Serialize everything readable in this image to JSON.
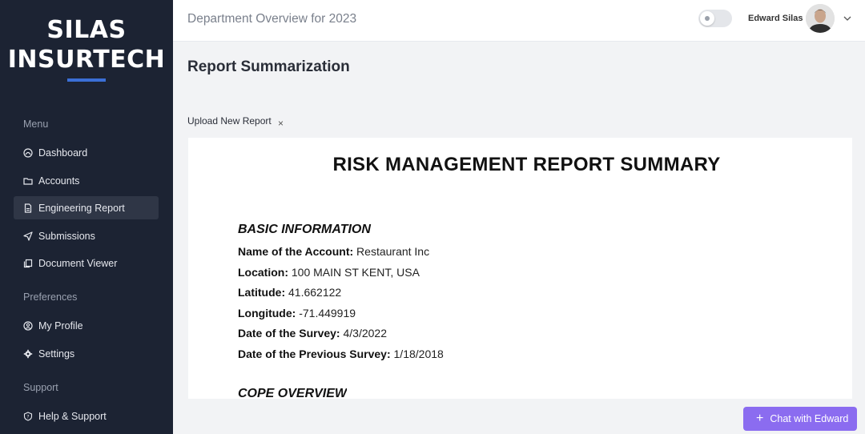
{
  "brand": {
    "line1": "SILAS",
    "line2": "INSURTECH",
    "accent": "#3b6fd6"
  },
  "sidebar": {
    "menu_label": "Menu",
    "items": [
      {
        "label": "Dashboard",
        "icon": "dashboard-icon"
      },
      {
        "label": "Accounts",
        "icon": "folder-icon"
      },
      {
        "label": "Engineering Report",
        "icon": "document-icon",
        "active": true
      },
      {
        "label": "Submissions",
        "icon": "send-icon"
      },
      {
        "label": "Document Viewer",
        "icon": "copy-icon"
      }
    ],
    "preferences_label": "Preferences",
    "preferences": [
      {
        "label": "My Profile",
        "icon": "user-circle-icon"
      },
      {
        "label": "Settings",
        "icon": "gear-icon"
      }
    ],
    "support_label": "Support",
    "support": [
      {
        "label": "Help & Support",
        "icon": "help-icon"
      }
    ]
  },
  "header": {
    "title": "Department Overview for 2023",
    "user_name": "Edward Silas"
  },
  "main": {
    "page_title": "Report Summarization",
    "upload_label": "Upload New Report",
    "close_symbol": "×"
  },
  "document": {
    "title": "RISK MANAGEMENT REPORT SUMMARY",
    "section1": "BASIC INFORMATION",
    "fields": [
      {
        "label": "Name of the Account:",
        "value": "Restaurant Inc"
      },
      {
        "label": "Location:",
        "value": "100 MAIN ST KENT, USA"
      },
      {
        "label": "Latitude:",
        "value": "41.662122"
      },
      {
        "label": "Longitude:",
        "value": "-71.449919"
      },
      {
        "label": "Date of the Survey:",
        "value": "4/3/2022"
      },
      {
        "label": "Date of the Previous Survey:",
        "value": "1/18/2018"
      }
    ],
    "section2": "COPE OVERVIEW"
  },
  "chat": {
    "label": "Chat with Edward",
    "color": "#8b6cf0"
  }
}
